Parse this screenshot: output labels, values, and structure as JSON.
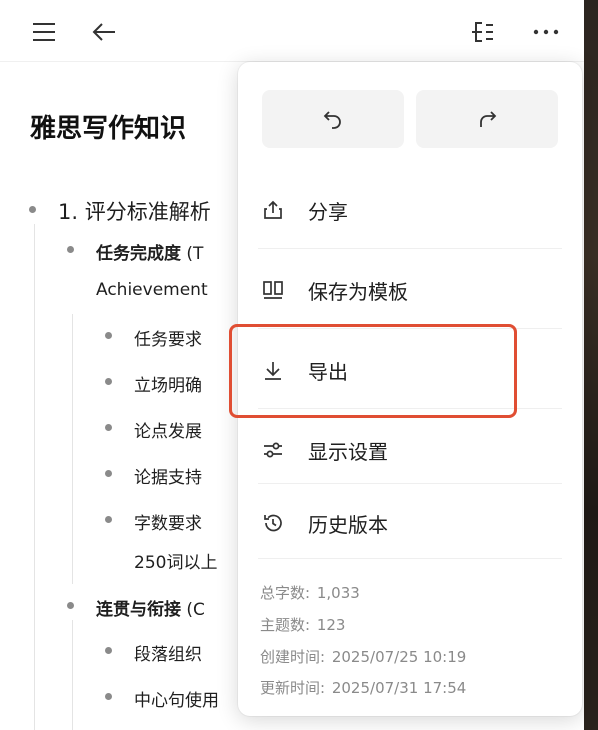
{
  "topbar": {
    "icons": [
      "menu-icon",
      "back-arrow-icon",
      "outline-icon",
      "more-icon"
    ]
  },
  "document": {
    "title": "雅思写作知识",
    "section": "1. 评分标准解析",
    "items": [
      {
        "bold": "任务完成度",
        "rest": " (T",
        "line2": "Achievement"
      },
      {
        "bold": "连贯与衔接",
        "rest": " (C"
      }
    ],
    "sub_a": [
      "任务要求",
      "立场明确",
      "论点发展",
      "论据支持",
      "字数要求",
      "250词以上"
    ],
    "sub_b": [
      "段落组织",
      "中心句使用"
    ]
  },
  "menu": {
    "undo_icon": "undo-icon",
    "redo_icon": "redo-icon",
    "items": [
      {
        "label": "分享",
        "icon": "share-icon"
      },
      {
        "label": "保存为模板",
        "icon": "template-icon"
      },
      {
        "label": "导出",
        "icon": "download-icon"
      },
      {
        "label": "显示设置",
        "icon": "settings-sliders-icon"
      },
      {
        "label": "历史版本",
        "icon": "history-icon"
      }
    ],
    "stats": {
      "word_label": "总字数:",
      "word_value": "1,033",
      "topic_label": "主题数:",
      "topic_value": "123",
      "created_label": "创建时间:",
      "created_value": "2025/07/25 10:19",
      "updated_label": "更新时间:",
      "updated_value": "2025/07/31 17:54"
    }
  },
  "colors": {
    "highlight": "#e04e33",
    "panel_bg": "#ffffff",
    "button_bg": "#f3f3f3"
  }
}
